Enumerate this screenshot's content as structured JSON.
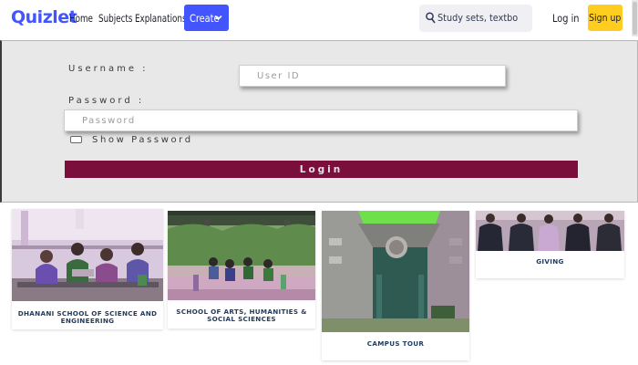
{
  "nav": {
    "logo": "Quizlet",
    "links": [
      "Home",
      "Subjects",
      "Explanations"
    ],
    "create_label": "Create",
    "search_placeholder": "Study sets, textbooks, ...",
    "login_label": "Log in",
    "signup_label": "Sign up",
    "colors": {
      "brand": "#4255ff",
      "signup": "#ffcd1f"
    }
  },
  "login": {
    "username_label": "Username :",
    "username_placeholder": "User ID",
    "password_label": "Password :",
    "password_placeholder": "Password",
    "show_password_label": "Show Password",
    "submit_label": "Login",
    "colors": {
      "button": "#7b0f3c"
    }
  },
  "cards": [
    {
      "caption": "DHANANI SCHOOL OF SCIENCE AND ENGINEERING"
    },
    {
      "caption": "SCHOOL OF ARTS, HUMANITIES & SOCIAL SCIENCES"
    },
    {
      "caption": "CAMPUS TOUR"
    },
    {
      "caption": "GIVING"
    }
  ]
}
